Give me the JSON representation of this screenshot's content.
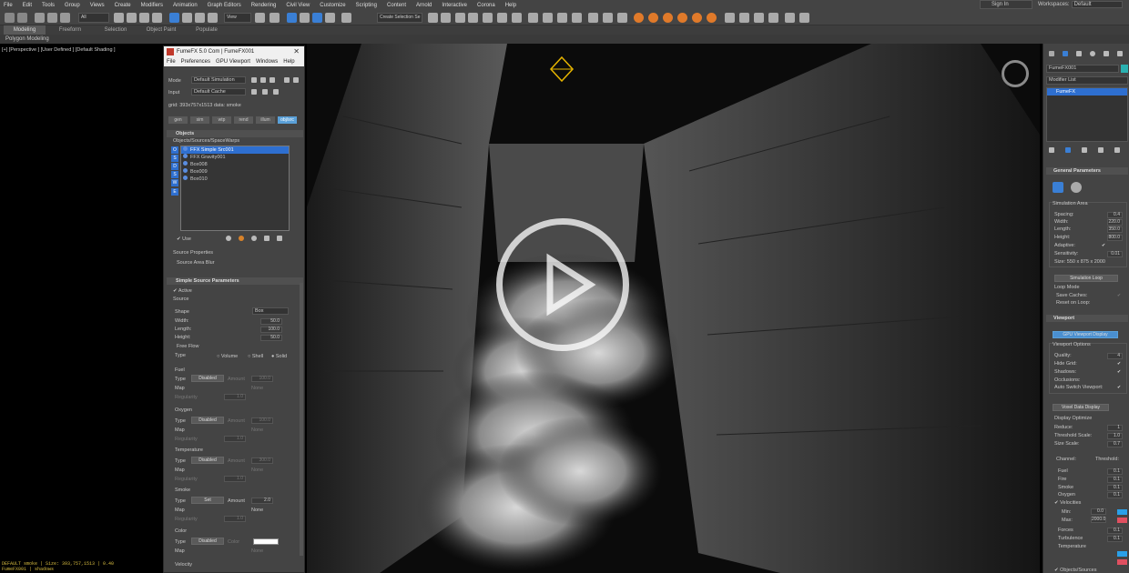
{
  "menu": [
    "File",
    "Edit",
    "Tools",
    "Group",
    "Views",
    "Create",
    "Modifiers",
    "Animation",
    "Graph Editors",
    "Rendering",
    "Civil View",
    "Customize",
    "Scripting",
    "Content",
    "Arnold",
    "Interactive",
    "Corona",
    "Help"
  ],
  "signin": "Sign In",
  "workspaces": {
    "label": "Workspaces:",
    "value": "Default"
  },
  "toolbar": {
    "filter": "All",
    "view": "View",
    "selset": "Create Selection Se"
  },
  "ribbon": {
    "tabs": [
      "Modeling",
      "Freeform",
      "Selection",
      "Object Paint",
      "Populate"
    ],
    "active": "Modeling",
    "sub": "Polygon Modeling"
  },
  "viewport": {
    "label": "[+] [Perspective ] [User Defined ] [Default Shading ]",
    "status1": "DEFAULT smoke  |  Size: 393,757,1513  |  0.40",
    "status2": "FumeFX001  |  shadows"
  },
  "fume": {
    "title": "FumeFX 5.0 Com | FumeFX001",
    "menu": [
      "File",
      "Preferences",
      "GPU Viewport",
      "Windows",
      "Help"
    ],
    "mode_label": "Mode",
    "mode_value": "Default Simulation",
    "input_label": "Input",
    "input_value": "Default Cache",
    "grid": "grid: 393x757x1513   data:  smoke",
    "tabs": [
      "gen",
      "sim",
      "wtp",
      "rend",
      "illum",
      "obj/src"
    ],
    "objects_title": "Objects",
    "list_label": "Objects/Sources/SpaceWarps",
    "list": [
      "FFX Simple Src001",
      "FFX Gravity001",
      "Box008",
      "Box009",
      "Box010"
    ],
    "side_btns": [
      "O",
      "S",
      "D",
      "S",
      "W",
      "E"
    ],
    "use": "Use",
    "source_props": "Source Properties",
    "source_blur": "Source Area Blur",
    "ssp_title": "Simple Source Parameters",
    "active": "Active",
    "source": "Source",
    "shape_label": "Shape",
    "shape_value": "Box",
    "width_label": "Width:",
    "width": "50.0",
    "length_label": "Length:",
    "length": "100.0",
    "height_label": "Height:",
    "height": "50.0",
    "freeflow": "Free Flow",
    "type_label": "Type",
    "volume": "Volume",
    "shell": "Shell",
    "solid": "Solid",
    "fuel": "Fuel",
    "oxygen": "Oxygen",
    "temperature": "Temperature",
    "smoke": "Smoke",
    "color": "Color",
    "velocity": "Velocity",
    "type": "Type",
    "map": "Map",
    "regularity": "Regularity",
    "amount": "Amount",
    "none": "None",
    "disabled": "Disabled",
    "set": "Set",
    "fuel_amount": "100.0",
    "ox_amount": "100.0",
    "temp_amount": "300.0",
    "smoke_amount": "2.0",
    "reg": "1.0",
    "color_label": "Color"
  },
  "right": {
    "name": "FumeFX001",
    "modlist": "Modifier List",
    "stack_item": "FumeFX",
    "gp_title": "General Parameters",
    "sim_area": "Simulation Area",
    "spacing_label": "Spacing:",
    "spacing": "0.4",
    "width_label": "Width:",
    "width": "220.0",
    "length_label": "Length:",
    "length": "350.0",
    "height_label": "Height:",
    "height": "800.0",
    "adaptive": "Adaptive:",
    "sensitivity_label": "Sensitivity:",
    "sensitivity": "0.01",
    "size": "Size:  550 x 875 x 2000",
    "sim_loop": "Simulation Loop",
    "loop_mode": "Loop Mode",
    "save_caches": "Save Caches:",
    "reset_loop": "Reset on Loop:",
    "vp_title": "Viewport",
    "gpu_btn": "GPU Viewport Display",
    "vp_options": "Viewport Options",
    "quality_label": "Quality:",
    "quality": "4",
    "hide_grid": "Hide Grid:",
    "shadows": "Shadows:",
    "occlusions": "Occlusions:",
    "auto_switch": "Auto Switch Viewport:",
    "voxel_btn": "Voxel Data Display",
    "disp_opt": "Display Optimize",
    "reduce_label": "Reduce:",
    "reduce": "1",
    "thresh_label": "Threshold Scale:",
    "thresh": "1.0",
    "sizescale_label": "Size Scale:",
    "sizescale": "0.7",
    "channel": "Channel:",
    "threshold": "Threshold:",
    "channels": [
      "Fuel",
      "Fire",
      "Smoke",
      "Oxygen"
    ],
    "chan_vals": [
      "0.1",
      "0.1",
      "0.1",
      "0.1"
    ],
    "velocities": "Velocities",
    "min_label": "Min:",
    "min": "0.0",
    "max_label": "Max:",
    "max": "2000.0",
    "forces": "Forces",
    "turbulence": "Turbulence",
    "temperature": "Temperature",
    "objsources": "Objects/Sources",
    "colors": {
      "accent": "#5aa0d8",
      "min_swatch": "#2aa0e8",
      "max_swatch": "#e05060"
    }
  }
}
